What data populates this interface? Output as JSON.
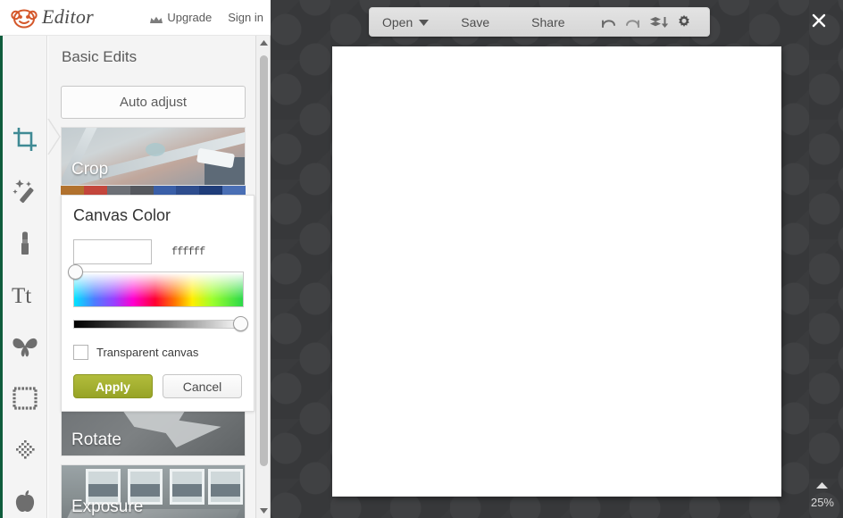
{
  "header": {
    "brand": "Editor",
    "logo_icon": "monkey-logo-icon",
    "upgrade_label": "Upgrade",
    "upgrade_icon": "crown-icon",
    "signin_label": "Sign in"
  },
  "sidebar": {
    "items": [
      {
        "icon": "crop-icon",
        "name": "crop",
        "selected": true
      },
      {
        "icon": "magic-wand-icon",
        "name": "effects",
        "selected": false
      },
      {
        "icon": "lipstick-icon",
        "name": "touch-up",
        "selected": false
      },
      {
        "icon": "text-tt-icon",
        "name": "text",
        "selected": false
      },
      {
        "icon": "butterfly-icon",
        "name": "overlays",
        "selected": false
      },
      {
        "icon": "frame-icon",
        "name": "frames",
        "selected": false
      },
      {
        "icon": "texture-icon",
        "name": "textures",
        "selected": false
      },
      {
        "icon": "apple-icon",
        "name": "themes",
        "selected": false
      }
    ]
  },
  "panel": {
    "title": "Basic Edits",
    "auto_adjust_label": "Auto adjust",
    "tools": [
      {
        "label": "Crop"
      },
      {
        "label": "Rotate"
      },
      {
        "label": "Exposure"
      }
    ],
    "scrollbar": {
      "up_icon": "scroll-up-arrow-icon",
      "down_icon": "scroll-down-arrow-icon"
    }
  },
  "canvas_color": {
    "title": "Canvas Color",
    "hex_value": "ffffff",
    "swatch_color": "#ffffff",
    "transparent_label": "Transparent canvas",
    "transparent_checked": false,
    "apply_label": "Apply",
    "cancel_label": "Cancel",
    "apply_color": "#a5b12e"
  },
  "toolbar": {
    "open_label": "Open",
    "open_caret_icon": "caret-down-icon",
    "save_label": "Save",
    "share_label": "Share",
    "undo_icon": "undo-icon",
    "redo_icon": "redo-icon",
    "flatten_icon": "layers-down-icon",
    "settings_icon": "gear-icon"
  },
  "window": {
    "close_icon": "close-x-icon"
  },
  "zoom_control": {
    "caret_icon": "caret-up-icon",
    "level": "25%"
  }
}
